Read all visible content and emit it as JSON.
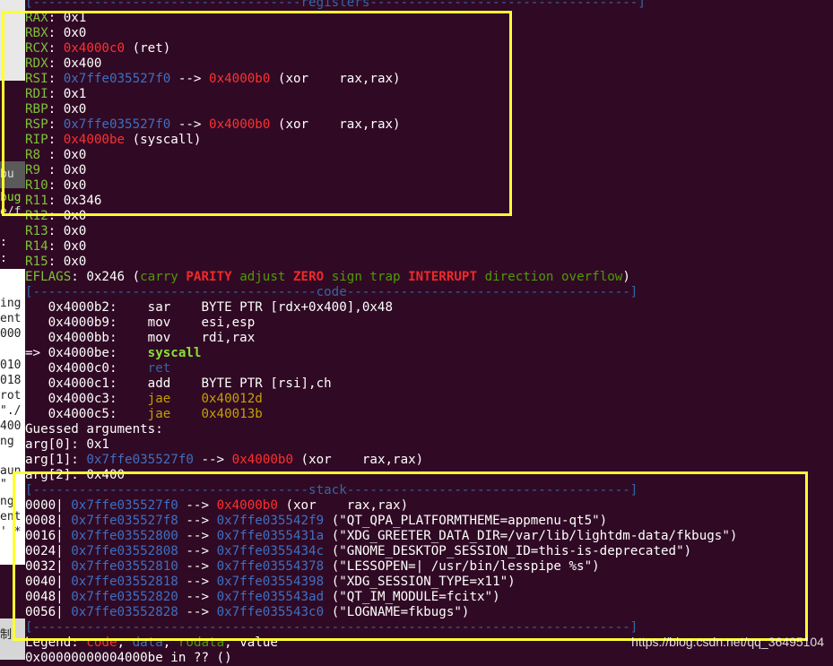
{
  "registers_header": "[-----------------------------------registers-----------------------------------]",
  "registers": [
    {
      "name": "RAX",
      "parts": [
        {
          "t": ": ",
          "c": "val"
        },
        {
          "t": "0x1",
          "c": "val"
        }
      ]
    },
    {
      "name": "RBX",
      "parts": [
        {
          "t": ": ",
          "c": "val"
        },
        {
          "t": "0x0",
          "c": "val"
        }
      ]
    },
    {
      "name": "RCX",
      "parts": [
        {
          "t": ": ",
          "c": "val"
        },
        {
          "t": "0x4000c0",
          "c": "code"
        },
        {
          "t": " (ret)",
          "c": "val"
        }
      ]
    },
    {
      "name": "RDX",
      "parts": [
        {
          "t": ": ",
          "c": "val"
        },
        {
          "t": "0x400",
          "c": "val"
        }
      ]
    },
    {
      "name": "RSI",
      "parts": [
        {
          "t": ": ",
          "c": "val"
        },
        {
          "t": "0x7ffe035527f0",
          "c": "addr"
        },
        {
          "t": " --> ",
          "c": "val"
        },
        {
          "t": "0x4000b0",
          "c": "code"
        },
        {
          "t": " (xor    rax,rax)",
          "c": "val"
        }
      ]
    },
    {
      "name": "RDI",
      "parts": [
        {
          "t": ": ",
          "c": "val"
        },
        {
          "t": "0x1",
          "c": "val"
        }
      ]
    },
    {
      "name": "RBP",
      "parts": [
        {
          "t": ": ",
          "c": "val"
        },
        {
          "t": "0x0",
          "c": "val"
        }
      ]
    },
    {
      "name": "RSP",
      "parts": [
        {
          "t": ": ",
          "c": "val"
        },
        {
          "t": "0x7ffe035527f0",
          "c": "addr"
        },
        {
          "t": " --> ",
          "c": "val"
        },
        {
          "t": "0x4000b0",
          "c": "code"
        },
        {
          "t": " (xor    rax,rax)",
          "c": "val"
        }
      ]
    },
    {
      "name": "RIP",
      "parts": [
        {
          "t": ": ",
          "c": "val"
        },
        {
          "t": "0x4000be",
          "c": "code"
        },
        {
          "t": " (syscall)",
          "c": "val"
        }
      ]
    },
    {
      "name": "R8 ",
      "parts": [
        {
          "t": ": ",
          "c": "val"
        },
        {
          "t": "0x0",
          "c": "val"
        }
      ]
    },
    {
      "name": "R9 ",
      "parts": [
        {
          "t": ": ",
          "c": "val"
        },
        {
          "t": "0x0",
          "c": "val"
        }
      ]
    },
    {
      "name": "R10",
      "parts": [
        {
          "t": ": ",
          "c": "val"
        },
        {
          "t": "0x0",
          "c": "val"
        }
      ]
    },
    {
      "name": "R11",
      "parts": [
        {
          "t": ": ",
          "c": "val"
        },
        {
          "t": "0x346",
          "c": "val"
        }
      ]
    },
    {
      "name": "R12",
      "parts": [
        {
          "t": ": ",
          "c": "val"
        },
        {
          "t": "0x0",
          "c": "val"
        }
      ]
    },
    {
      "name": "R13",
      "parts": [
        {
          "t": ": ",
          "c": "val"
        },
        {
          "t": "0x0",
          "c": "val"
        }
      ]
    },
    {
      "name": "R14",
      "parts": [
        {
          "t": ": ",
          "c": "val"
        },
        {
          "t": "0x0",
          "c": "val"
        }
      ]
    },
    {
      "name": "R15",
      "parts": [
        {
          "t": ": ",
          "c": "val"
        },
        {
          "t": "0x0",
          "c": "val"
        }
      ]
    }
  ],
  "eflags": {
    "label": "EFLAGS",
    "value": ": 0x246 (",
    "flags": [
      {
        "t": "carry",
        "on": false
      },
      {
        "t": "PARITY",
        "on": true
      },
      {
        "t": "adjust",
        "on": false
      },
      {
        "t": "ZERO",
        "on": true
      },
      {
        "t": "sign",
        "on": false
      },
      {
        "t": "trap",
        "on": false
      },
      {
        "t": "INTERRUPT",
        "on": true
      },
      {
        "t": "direction",
        "on": false
      },
      {
        "t": "overflow",
        "on": false
      }
    ],
    "close": ")"
  },
  "code_header": "[-------------------------------------code-------------------------------------]",
  "code": [
    {
      "prefix": "   ",
      "addr": "0x4000b2:",
      "mn": "sar",
      "mnc": "val",
      "ops": "BYTE PTR [rdx+0x400],0x48",
      "opc": "val"
    },
    {
      "prefix": "   ",
      "addr": "0x4000b9:",
      "mn": "mov",
      "mnc": "val",
      "ops": "esi,esp",
      "opc": "val"
    },
    {
      "prefix": "   ",
      "addr": "0x4000bb:",
      "mn": "mov",
      "mnc": "val",
      "ops": "rdi,rax",
      "opc": "val"
    },
    {
      "prefix": "=> ",
      "addr": "0x4000be:",
      "mn": "syscall",
      "mnc": "cur",
      "ops": "",
      "opc": "val"
    },
    {
      "prefix": "   ",
      "addr": "0x4000c0:",
      "mn": "ret",
      "mnc": "ret",
      "ops": "",
      "opc": "val"
    },
    {
      "prefix": "   ",
      "addr": "0x4000c1:",
      "mn": "add",
      "mnc": "val",
      "ops": "BYTE PTR [rsi],ch",
      "opc": "val"
    },
    {
      "prefix": "   ",
      "addr": "0x4000c3:",
      "mn": "jae",
      "mnc": "jmp",
      "ops": "0x40012d",
      "opc": "jmp"
    },
    {
      "prefix": "   ",
      "addr": "0x4000c5:",
      "mn": "jae",
      "mnc": "jmp",
      "ops": "0x40013b",
      "opc": "jmp"
    }
  ],
  "guessed_title": "Guessed arguments:",
  "args": [
    [
      {
        "t": "arg[0]: 0x1",
        "c": "val"
      }
    ],
    [
      {
        "t": "arg[1]: ",
        "c": "val"
      },
      {
        "t": "0x7ffe035527f0",
        "c": "addr"
      },
      {
        "t": " --> ",
        "c": "val"
      },
      {
        "t": "0x4000b0",
        "c": "code"
      },
      {
        "t": " (xor    rax,rax)",
        "c": "val"
      }
    ],
    [
      {
        "t": "arg[2]: 0x400",
        "c": "val"
      }
    ]
  ],
  "stack_header": "[------------------------------------stack-------------------------------------]",
  "stack": [
    {
      "off": "0000|",
      "addr": "0x7ffe035527f0",
      "target": "0x4000b0",
      "tc": "code",
      "desc": " (xor    rax,rax)"
    },
    {
      "off": "0008|",
      "addr": "0x7ffe035527f8",
      "target": "0x7ffe035542f9",
      "tc": "addr",
      "desc": " (\"QT_QPA_PLATFORMTHEME=appmenu-qt5\")"
    },
    {
      "off": "0016|",
      "addr": "0x7ffe03552800",
      "target": "0x7ffe0355431a",
      "tc": "addr",
      "desc": " (\"XDG_GREETER_DATA_DIR=/var/lib/lightdm-data/fkbugs\")"
    },
    {
      "off": "0024|",
      "addr": "0x7ffe03552808",
      "target": "0x7ffe0355434c",
      "tc": "addr",
      "desc": " (\"GNOME_DESKTOP_SESSION_ID=this-is-deprecated\")"
    },
    {
      "off": "0032|",
      "addr": "0x7ffe03552810",
      "target": "0x7ffe03554378",
      "tc": "addr",
      "desc": " (\"LESSOPEN=| /usr/bin/lesspipe %s\")"
    },
    {
      "off": "0040|",
      "addr": "0x7ffe03552818",
      "target": "0x7ffe03554398",
      "tc": "addr",
      "desc": " (\"XDG_SESSION_TYPE=x11\")"
    },
    {
      "off": "0048|",
      "addr": "0x7ffe03552820",
      "target": "0x7ffe035543ad",
      "tc": "addr",
      "desc": " (\"QT_IM_MODULE=fcitx\")"
    },
    {
      "off": "0056|",
      "addr": "0x7ffe03552828",
      "target": "0x7ffe035543c0",
      "tc": "addr",
      "desc": " (\"LOGNAME=fkbugs\")"
    }
  ],
  "footer_rule": "[------------------------------------------------------------------------------]",
  "legend": {
    "label": "Legend: ",
    "code": "code",
    "rodata": "rodata",
    "data": "data",
    "value": "value",
    "sep": ", "
  },
  "last_line": "0x00000000004000be in ?? ()",
  "left_strip": [
    "bu",
    "bug",
    "e/f",
    ":",
    ":",
    "ing",
    "ent",
    "000",
    "010",
    "018",
    "rot",
    "\"./",
    "400",
    "ng",
    "aun",
    "\"",
    "ng",
    "ent",
    "' *",
    "制"
  ],
  "watermark": "https://blog.csdn.net/qq_36495104"
}
